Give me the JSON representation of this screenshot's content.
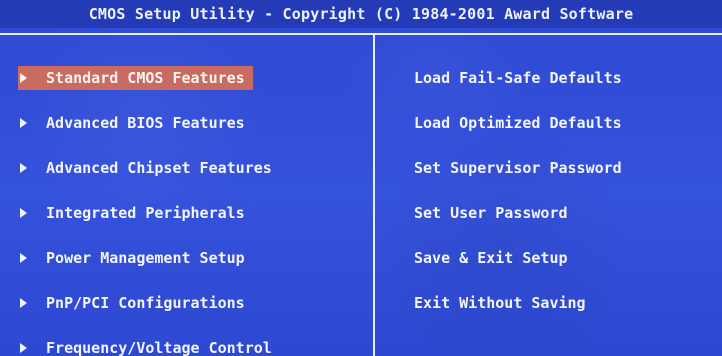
{
  "header": {
    "title": "CMOS Setup Utility - Copyright (C) 1984-2001 Award Software"
  },
  "left_menu": [
    {
      "label": "Standard CMOS Features",
      "icon": "arrow-right-icon"
    },
    {
      "label": "Advanced BIOS Features",
      "icon": "arrow-right-icon"
    },
    {
      "label": "Advanced Chipset Features",
      "icon": "arrow-right-icon"
    },
    {
      "label": "Integrated Peripherals",
      "icon": "arrow-right-icon"
    },
    {
      "label": "Power Management Setup",
      "icon": "arrow-right-icon"
    },
    {
      "label": "PnP/PCI Configurations",
      "icon": "arrow-right-icon"
    },
    {
      "label": "Frequency/Voltage Control",
      "icon": "arrow-right-icon"
    }
  ],
  "right_menu": [
    {
      "label": "Load Fail-Safe Defaults"
    },
    {
      "label": "Load Optimized Defaults"
    },
    {
      "label": "Set Supervisor Password"
    },
    {
      "label": "Set User Password"
    },
    {
      "label": "Save & Exit Setup"
    },
    {
      "label": "Exit Without Saving"
    }
  ],
  "colors": {
    "background": "#3552dc",
    "title_bar": "#243bb8",
    "selected_background": "#c96b61",
    "text": "#f3f5ff",
    "frame_lines": "#e8ecff"
  }
}
